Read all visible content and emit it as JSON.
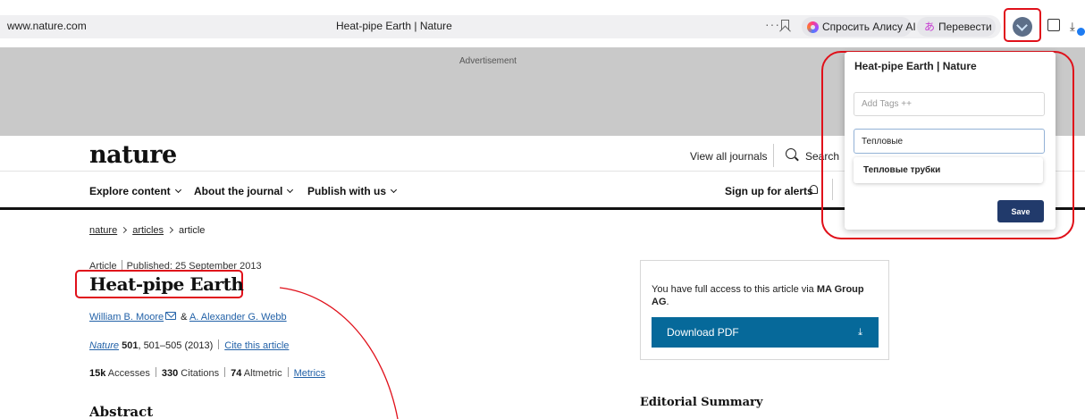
{
  "browser": {
    "url": "www.nature.com",
    "tab_title": "Heat-pipe Earth | Nature",
    "more_icon": "···",
    "alisa_label": "Спросить Алису AI",
    "translate_label": "Перевести",
    "translate_icon": "あ",
    "downloads_icon": "⤓"
  },
  "ad": {
    "label": "Advertisement"
  },
  "site": {
    "logo": "nature",
    "view_all_journals": "View all journals",
    "search": "Search",
    "nav": [
      "Explore content",
      "About the journal",
      "Publish with us"
    ],
    "alerts": "Sign up for alerts"
  },
  "breadcrumb": [
    "nature",
    "articles",
    "article"
  ],
  "article": {
    "type": "Article",
    "published": "Published: 25 September 2013",
    "title": "Heat-pipe Earth",
    "author1": "William B. Moore",
    "author_sep": " & ",
    "author2": "A. Alexander G. Webb",
    "journal": "Nature",
    "volume": "501",
    "pages": ", 501–505 (2013)",
    "cite": "Cite this article",
    "accesses_num": "15k",
    "accesses_label": " Accesses",
    "citations_num": "330",
    "citations_label": " Citations",
    "altmetric_num": "74",
    "altmetric_label": " Altmetric",
    "metrics_link": "Metrics",
    "abstract_heading": "Abstract"
  },
  "access_box": {
    "text_prefix": "You have full access to this article via ",
    "institution": "MA Group AG",
    "text_suffix": ".",
    "download": "Download PDF",
    "download_icon": "⤓"
  },
  "editorial": {
    "heading": "Editorial Summary"
  },
  "popup": {
    "title": "Heat-pipe Earth | Nature",
    "tags_placeholder": "Add Tags ++",
    "tag_value": "Тепловые",
    "suggestion": "Тепловые трубки",
    "save": "Save"
  },
  "colors": {
    "annotation": "#e0101a",
    "download_button": "#06699a",
    "save_button": "#213a6b",
    "link": "#2362a8"
  }
}
